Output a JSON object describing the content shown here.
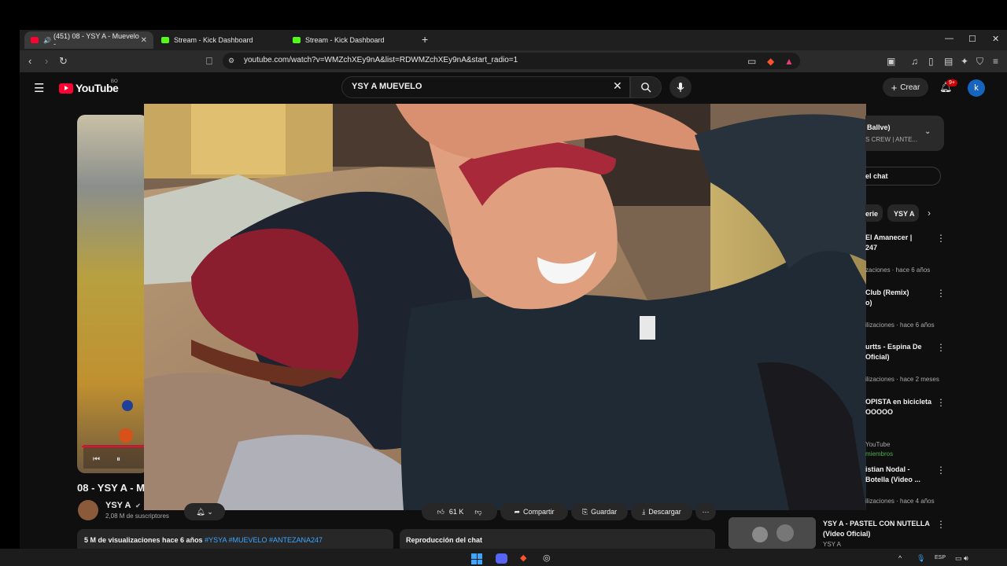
{
  "browser": {
    "tabs": [
      {
        "title": "(451) 08 - YSY A - Muevelo -",
        "icon": "youtube-icon",
        "active": true
      },
      {
        "title": "Stream - Kick Dashboard",
        "icon": "kick-icon",
        "active": false
      },
      {
        "title": "Stream - Kick Dashboard",
        "icon": "kick-icon",
        "active": false
      }
    ],
    "url": "youtube.com/watch?v=WMZchXEy9nA&list=RDWMZchXEy9nA&start_radio=1"
  },
  "youtube": {
    "logo_text": "YouTube",
    "country_code": "BO",
    "search_value": "YSY A  MUEVELO",
    "create_label": "Crear",
    "notification_badge": "9+",
    "avatar_letter": "k",
    "accent_color": "#ff0033"
  },
  "video": {
    "title": "08 - YSY A - M",
    "channel_name": "YSY A",
    "subscribers": "2,08 M de suscriptores",
    "likes": "61 K",
    "share_label": "Compartir",
    "save_label": "Guardar",
    "download_label": "Descargar",
    "description_stats": "5 M de visualizaciones  hace 6 años",
    "description_tags": "#YSYA #MUEVELO #ANTEZANA247",
    "chat_replay_label": "Reproducción del chat"
  },
  "right_panel": {
    "playlist_title": "Ballve)",
    "playlist_sub": "S CREW | ANTE...",
    "chat_button": "el chat",
    "chips": [
      "erie",
      "YSY A"
    ],
    "recommendations": [
      {
        "title_line1": "El Amanecer |",
        "title_line2": "247",
        "meta": "zaciones · hace 6 años"
      },
      {
        "title_line1": "Club (Remix)",
        "title_line2": "o)",
        "meta": "ilizaciones · hace 6 años"
      },
      {
        "title_line1": "urtts - Espina De",
        "title_line2": "Oficial)",
        "meta": "ilizaciones · hace 2 meses"
      },
      {
        "title_line1": "OPISTA en bicicleta",
        "title_line2": "OOOOO",
        "meta": "YouTube",
        "meta2": "miembros"
      },
      {
        "title_line1": "istian Nodal -",
        "title_line2": "Botella (Video ...",
        "meta": "ilizaciones · hace 4 años"
      },
      {
        "title_line1": "YSY A - PASTEL CON NUTELLA",
        "title_line2": "(Video Oficial)",
        "meta": "YSY A"
      }
    ]
  },
  "taskbar": {
    "language": "ESP"
  }
}
